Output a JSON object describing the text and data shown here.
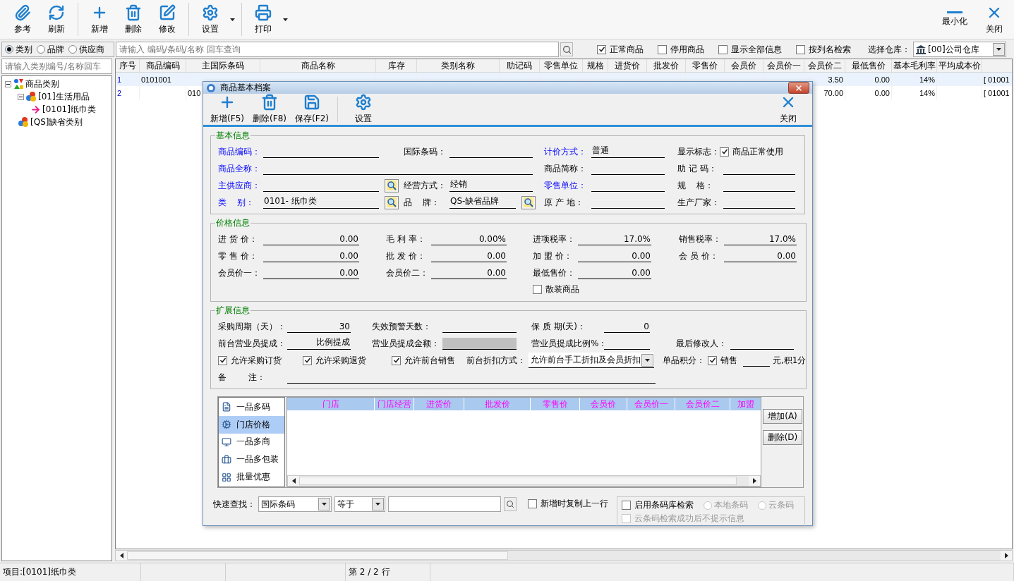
{
  "toolbar": {
    "groups": [
      [
        {
          "kind": "attach",
          "label": "参考"
        },
        {
          "kind": "refresh",
          "label": "刷新"
        }
      ],
      [
        {
          "kind": "add",
          "label": "新增"
        },
        {
          "kind": "delete",
          "label": "删除"
        },
        {
          "kind": "edit",
          "label": "修改"
        }
      ],
      [
        {
          "kind": "settings",
          "label": "设置",
          "menu": true
        }
      ],
      [
        {
          "kind": "print",
          "label": "打印",
          "menu": true
        }
      ]
    ],
    "window_buttons": [
      {
        "kind": "minimize",
        "label": "最小化"
      },
      {
        "kind": "close",
        "label": "关闭"
      }
    ]
  },
  "filter_bar": {
    "modes": [
      {
        "label": "类别",
        "selected": true
      },
      {
        "label": "品牌",
        "selected": false
      },
      {
        "label": "供应商",
        "selected": false
      }
    ],
    "search": {
      "placeholder": "请输入 编码/条码/名称 回车查询"
    },
    "options": [
      {
        "label": "正常商品",
        "checked": true
      },
      {
        "label": "停用商品",
        "checked": false
      },
      {
        "label": "显示全部信息",
        "checked": false
      },
      {
        "label": "按列名检索",
        "checked": false
      }
    ],
    "warehouse": {
      "label": "选择仓库：",
      "value": "[00]公司仓库"
    }
  },
  "category_panel": {
    "search": {
      "placeholder": "请输入类别编号/名称回车"
    },
    "tree": [
      {
        "label": "商品类别",
        "expanded": true,
        "children": [
          {
            "label": "[01]生活用品",
            "expanded": true,
            "children": [
              {
                "label": "[0101]纸巾类"
              }
            ]
          },
          {
            "label": "[QS]缺省类别"
          }
        ]
      }
    ]
  },
  "table": {
    "columns": [
      "序号",
      "商品编码",
      "主国际条码",
      "商品名称",
      "库存",
      "类别名称",
      "助记码",
      "零售单位",
      "规格",
      "进货价",
      "批发价",
      "零售价",
      "会员价",
      "会员价一",
      "会员价二",
      "最低售价",
      "基本毛利率",
      "平均成本价"
    ],
    "rows": [
      [
        "1",
        "0101001",
        null,
        null,
        null,
        null,
        null,
        null,
        null,
        null,
        null,
        null,
        null,
        null,
        "3.50",
        "0.00",
        "14%",
        null,
        "[ 01001"
      ],
      [
        "2",
        null,
        "010",
        null,
        null,
        null,
        null,
        null,
        null,
        null,
        null,
        null,
        null,
        null,
        "70.00",
        "0.00",
        "14%",
        null,
        "[ 01001"
      ]
    ]
  },
  "status_bar": {
    "item": "项目:[0101]纸巾类",
    "rows": "第 2 / 2 行"
  },
  "dialog": {
    "title": "商品基本档案",
    "toolbar": [
      {
        "kind": "add",
        "label": "新增(F5)"
      },
      {
        "kind": "delete",
        "label": "删除(F8)"
      },
      {
        "kind": "save",
        "label": "保存(F2)"
      },
      {
        "kind": "settings",
        "label": "设置"
      }
    ],
    "close": {
      "label": "关闭"
    },
    "basic_info": {
      "title": "基本信息",
      "rows": [
        [
          {
            "kind": "text",
            "label": "商品编码：",
            "required": true
          },
          {
            "kind": "text",
            "label": "国际条码：",
            "required": false
          },
          {
            "kind": "text",
            "label": "计价方式：",
            "required": true,
            "value": "普通"
          },
          {
            "kind": "check",
            "label": "显示标志：",
            "text": "商品正常使用",
            "checked": true
          }
        ],
        [
          {
            "kind": "wide",
            "label": "商品全称：",
            "required": true
          },
          "",
          {
            "kind": "text",
            "label": "商品简称：",
            "required": false
          },
          {
            "kind": "text",
            "label": "助 记 码：",
            "required": false
          }
        ],
        [
          {
            "kind": "lookup",
            "label": "主供应商：",
            "required": true
          },
          {
            "kind": "text",
            "label": "经营方式：",
            "required": false,
            "value": "经销"
          },
          {
            "kind": "text",
            "label": "零售单位：",
            "required": true
          },
          {
            "kind": "text",
            "label": "规    格：",
            "required": false
          }
        ],
        [
          {
            "kind": "lookup",
            "label": "类    别：",
            "required": true,
            "value": "0101- 纸巾类"
          },
          {
            "kind": "lookup",
            "label": "品    牌：",
            "required": false,
            "value": "QS-缺省品牌"
          },
          {
            "kind": "text",
            "label": "原 产 地：",
            "required": false
          },
          {
            "kind": "text",
            "label": "生产厂家：",
            "required": false
          }
        ]
      ]
    },
    "price_info": {
      "title": "价格信息",
      "rows": [
        [
          {
            "kind": "number",
            "label": "进 货 价：",
            "value": "0.00"
          },
          {
            "kind": "number",
            "label": "毛 利 率：",
            "value": "0.00%"
          },
          {
            "kind": "number",
            "label": "进项税率：",
            "value": "17.0%"
          },
          {
            "kind": "number",
            "label": "销售税率：",
            "value": "17.0%"
          }
        ],
        [
          {
            "kind": "number",
            "label": "零 售 价：",
            "value": "0.00"
          },
          {
            "kind": "number",
            "label": "批 发 价：",
            "value": "0.00"
          },
          {
            "kind": "number",
            "label": "加 盟 价：",
            "value": "0.00"
          },
          {
            "kind": "number",
            "label": "会 员 价：",
            "value": "0.00"
          }
        ],
        [
          {
            "kind": "number",
            "label": "会员价一：",
            "value": "0.00"
          },
          {
            "kind": "number",
            "label": "会员价二：",
            "value": "0.00"
          },
          {
            "kind": "number",
            "label": "最低售价：",
            "value": "0.00"
          }
        ]
      ],
      "bulk": {
        "label": "散装商品",
        "checked": false
      }
    },
    "extended_info": {
      "title": "扩展信息",
      "rows": [
        [
          {
            "kind": "number",
            "label": "采购周期（天）：",
            "value": "30"
          },
          {
            "kind": "text",
            "label": "失效预警天数："
          },
          {
            "kind": "number",
            "label": "保 质 期(天)：",
            "value": "0"
          }
        ],
        [
          {
            "kind": "number",
            "label": "前台营业员提成：",
            "value": "比例提成"
          },
          {
            "kind": "text",
            "label": "营业员提成金额：",
            "disabled": true
          },
          {
            "kind": "text",
            "label": "营业员提成比例%："
          },
          {
            "kind": "text",
            "label": "最后修改人："
          }
        ]
      ],
      "options": [
        {
          "kind": "checkbox",
          "text": "允许采购订货",
          "checked": true
        },
        {
          "kind": "checkbox",
          "text": "允许采购退货",
          "checked": true
        },
        {
          "kind": "checkbox",
          "text": "允许前台销售",
          "checked": true
        },
        {
          "kind": "select",
          "label": "前台折扣方式：",
          "value": "允许前台手工折扣及会员折扣"
        },
        {
          "kind": "points",
          "label": "单品积分：",
          "text": "销售",
          "checked": true,
          "suffix": "元,积1分"
        }
      ],
      "remark": {
        "kind": "wide",
        "label": "备        注："
      }
    },
    "detail_tabs": [
      {
        "kind": "list",
        "label": "一品多码",
        "selected": false
      },
      {
        "kind": "gear",
        "label": "门店价格",
        "selected": true
      },
      {
        "kind": "monitor",
        "label": "一品多商",
        "selected": false
      },
      {
        "kind": "package",
        "label": "一品多包装",
        "selected": false
      },
      {
        "kind": "grid",
        "label": "批量优惠",
        "selected": false
      }
    ],
    "store_grid": {
      "columns": [
        "门店",
        "门店经营",
        "进货价",
        "批发价",
        "零售价",
        "会员价",
        "会员价一",
        "会员价二",
        "加盟"
      ]
    },
    "grid_buttons": [
      "增加(A)",
      "删除(D)"
    ],
    "quick_find": {
      "label": "快速查找：",
      "field": "国际条码",
      "operator": "等于",
      "copy_previous": {
        "label": "新增时复制上一行",
        "checked": false
      }
    },
    "barcode_lookup": {
      "enable": {
        "label": "启用条码库检索",
        "checked": false
      },
      "sources": [
        {
          "label": "本地条码",
          "selected": false,
          "disabled": true
        },
        {
          "label": "云条码",
          "selected": false,
          "disabled": true
        }
      ],
      "silent": {
        "label": "云条码检索成功后不提示信息",
        "checked": false,
        "disabled": true
      }
    }
  }
}
